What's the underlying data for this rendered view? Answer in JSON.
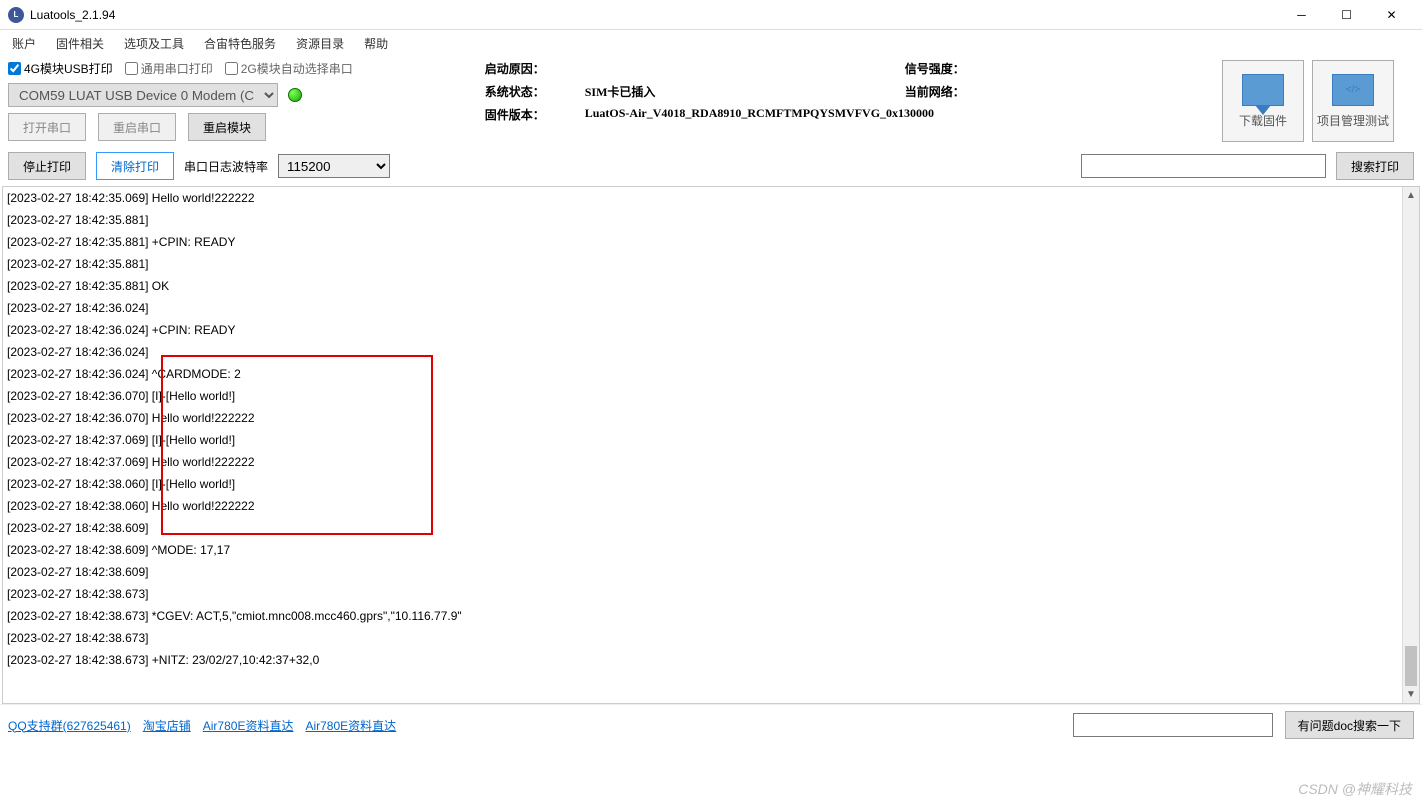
{
  "window": {
    "title": "Luatools_2.1.94",
    "icon_label": "L"
  },
  "menu": [
    "账户",
    "固件相关",
    "选项及工具",
    "合宙特色服务",
    "资源目录",
    "帮助"
  ],
  "checkboxes": {
    "usb4g": {
      "label": "4G模块USB打印",
      "checked": true
    },
    "generic": {
      "label": "通用串口打印",
      "checked": false
    },
    "auto2g": {
      "label": "2G模块自动选择串口",
      "checked": false
    }
  },
  "device_select": "COM59 LUAT USB Device 0 Modem (C",
  "buttons": {
    "open_port": "打开串口",
    "reset_port": "重启串口",
    "reset_module": "重启模块",
    "stop_print": "停止打印",
    "clear_print": "清除打印",
    "search_print": "搜索打印",
    "download_fw": "下载固件",
    "project_mgr": "项目管理测试",
    "doc_search": "有问题doc搜索一下"
  },
  "labels": {
    "baud": "串口日志波特率"
  },
  "baud_value": "115200",
  "info": {
    "reason_label": "启动原因：",
    "reason_value": "",
    "signal_label": "信号强度：",
    "signal_value": "",
    "sys_label": "系统状态：",
    "sys_value": "SIM卡已插入",
    "net_label": "当前网络：",
    "net_value": "",
    "fw_label": "固件版本：",
    "fw_value": "LuatOS-Air_V4018_RDA8910_RCMFTMPQYSMVFVG_0x130000"
  },
  "log": {
    "lines": [
      "[2023-02-27 18:42:35.069] Hello world!222222",
      "[2023-02-27 18:42:35.881]",
      "[2023-02-27 18:42:35.881] +CPIN: READY",
      "[2023-02-27 18:42:35.881]",
      "[2023-02-27 18:42:35.881] OK",
      "[2023-02-27 18:42:36.024]",
      "[2023-02-27 18:42:36.024] +CPIN: READY",
      "[2023-02-27 18:42:36.024]",
      "[2023-02-27 18:42:36.024] ^CARDMODE: 2",
      "[2023-02-27 18:42:36.070] [I]-[Hello world!]",
      "[2023-02-27 18:42:36.070] Hello world!222222",
      "[2023-02-27 18:42:37.069] [I]-[Hello world!]",
      "[2023-02-27 18:42:37.069] Hello world!222222",
      "[2023-02-27 18:42:38.060] [I]-[Hello world!]",
      "[2023-02-27 18:42:38.060] Hello world!222222",
      "[2023-02-27 18:42:38.609]",
      "[2023-02-27 18:42:38.609] ^MODE: 17,17",
      "[2023-02-27 18:42:38.609]",
      "[2023-02-27 18:42:38.673]",
      "[2023-02-27 18:42:38.673] *CGEV: ACT,5,\"cmiot.mnc008.mcc460.gprs\",\"10.116.77.9\"",
      "[2023-02-27 18:42:38.673]",
      "[2023-02-27 18:42:38.673] +NITZ: 23/02/27,10:42:37+32,0"
    ]
  },
  "footer_links": [
    "QQ支持群(627625461)",
    "淘宝店铺",
    "Air780E资料直达",
    "Air780E资料直达"
  ],
  "watermark": "CSDN @神耀科技"
}
